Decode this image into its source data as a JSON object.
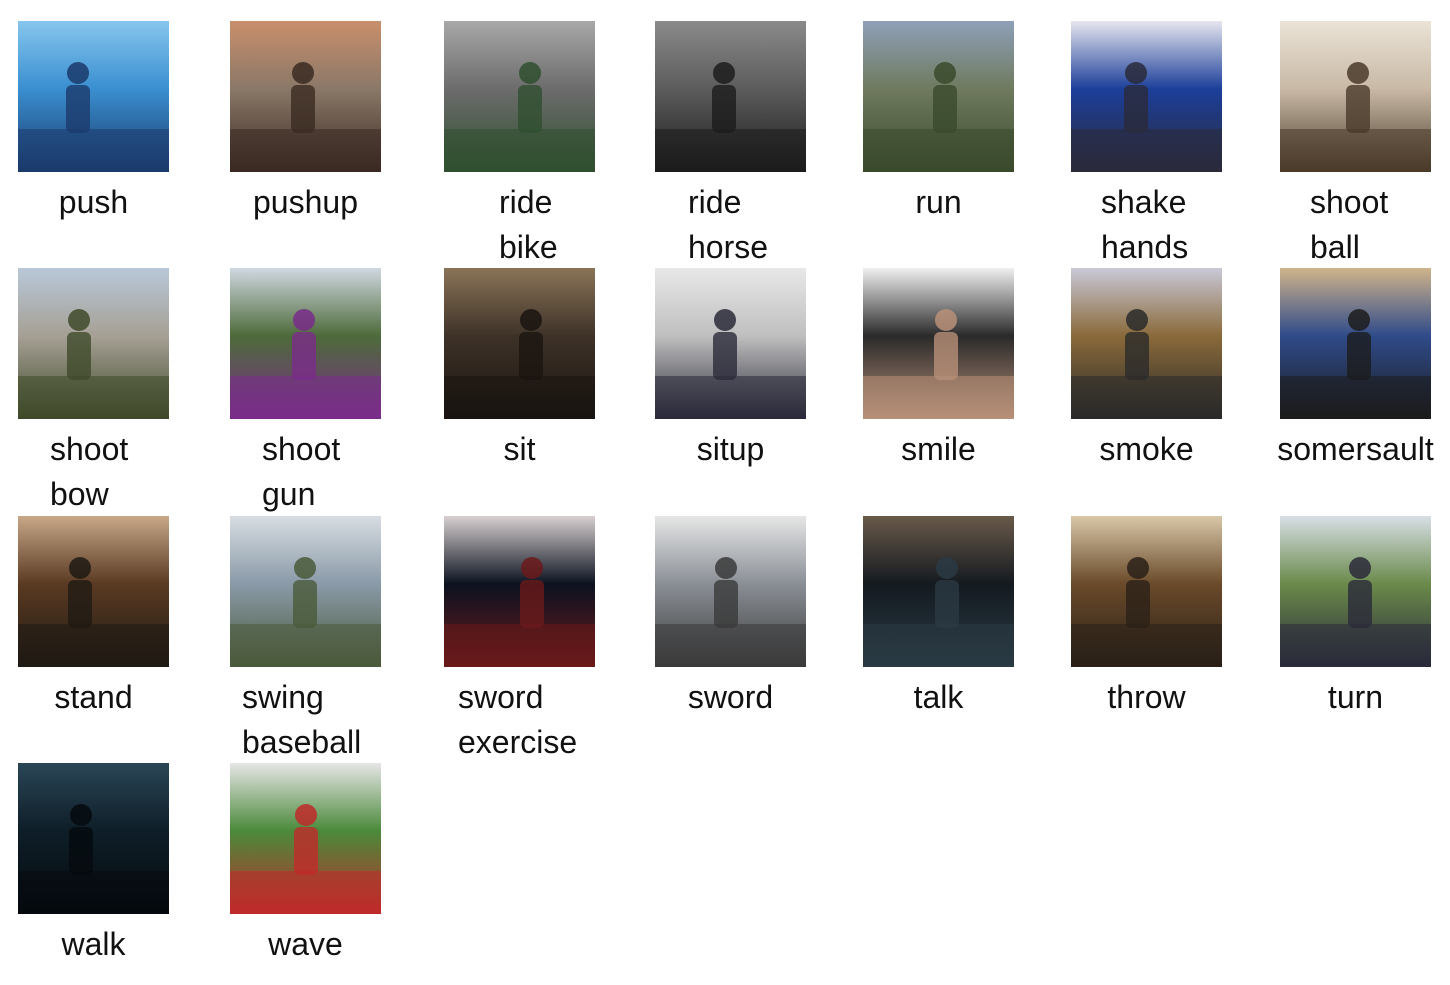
{
  "items": [
    {
      "label": "push",
      "thumb": "person-pushing-outdoors-thumbnail",
      "colors": [
        "#3a8fd0",
        "#86c6ee",
        "#1b3a6b"
      ]
    },
    {
      "label": "pushup",
      "thumb": "person-doing-pushup-thumbnail",
      "colors": [
        "#8a7868",
        "#c98f6b",
        "#3a2a22"
      ]
    },
    {
      "label": "ride\nbike",
      "thumb": "cycling-race-broadcast-thumbnail",
      "colors": [
        "#6c6c6c",
        "#a8a8a8",
        "#2f4f2f"
      ]
    },
    {
      "label": "ride\nhorse",
      "thumb": "horse-race-grayscale-thumbnail",
      "colors": [
        "#5c5c5c",
        "#8a8a8a",
        "#1c1c1c"
      ]
    },
    {
      "label": "run",
      "thumb": "person-running-parking-lot-thumbnail",
      "colors": [
        "#6f7a5e",
        "#8ea0b8",
        "#3a4a2c"
      ]
    },
    {
      "label": "shake\nhands",
      "thumb": "wrestlers-shaking-hands-thumbnail",
      "colors": [
        "#1c3f9a",
        "#e6e6ef",
        "#2a2a3a"
      ]
    },
    {
      "label": "shoot\nball",
      "thumb": "basketball-gym-thumbnail",
      "colors": [
        "#c9b9a6",
        "#eae3d6",
        "#4a3a2a"
      ]
    },
    {
      "label": "shoot\nbow",
      "thumb": "person-shooting-pistol-thumbnail",
      "colors": [
        "#a6a095",
        "#b8c8d8",
        "#3f4a2a"
      ]
    },
    {
      "label": "shoot\ngun",
      "thumb": "archer-drawing-bow-thumbnail",
      "colors": [
        "#4d6b3a",
        "#d0d8e0",
        "#7a2c8a"
      ]
    },
    {
      "label": "sit",
      "thumb": "people-sitting-indoors-thumbnail",
      "colors": [
        "#3e3228",
        "#8a7458",
        "#1a1410"
      ]
    },
    {
      "label": "situp",
      "thumb": "person-doing-situp-garage-thumbnail",
      "colors": [
        "#bfbfbf",
        "#e8e8e8",
        "#2a2a3a"
      ]
    },
    {
      "label": "smile",
      "thumb": "person-smiling-webcam-thumbnail",
      "colors": [
        "#2a2a2a",
        "#f0f0f0",
        "#b89078"
      ]
    },
    {
      "label": "smoke",
      "thumb": "person-smoking-room-thumbnail",
      "colors": [
        "#8a6a3a",
        "#c9c9d8",
        "#2a2a2a"
      ]
    },
    {
      "label": "somersault",
      "thumb": "gymnast-on-beam-thumbnail",
      "colors": [
        "#2f4b8a",
        "#d0b48a",
        "#1c1c1c"
      ]
    },
    {
      "label": "stand",
      "thumb": "man-standing-at-desk-thumbnail",
      "colors": [
        "#5a3a22",
        "#c8a888",
        "#1f1a14"
      ]
    },
    {
      "label": "swing\nbaseball",
      "thumb": "batting-cage-thumbnail",
      "colors": [
        "#8a9aa8",
        "#d8dde2",
        "#4a5a3a"
      ]
    },
    {
      "label": "sword\nexercise",
      "thumb": "sword-exercise-spotlight-thumbnail",
      "colors": [
        "#0c1220",
        "#d8d0d0",
        "#6a1a1a"
      ]
    },
    {
      "label": "sword",
      "thumb": "person-with-sword-street-thumbnail",
      "colors": [
        "#8a8f96",
        "#e6e6e6",
        "#3a3a3a"
      ]
    },
    {
      "label": "talk",
      "thumb": "person-talking-dark-thumbnail",
      "colors": [
        "#141a20",
        "#6a5a4a",
        "#2a3a44"
      ]
    },
    {
      "label": "throw",
      "thumb": "person-throwing-indoors-thumbnail",
      "colors": [
        "#6a4a2a",
        "#d8c8a8",
        "#2a2018"
      ]
    },
    {
      "label": "turn",
      "thumb": "person-turning-by-fence-thumbnail",
      "colors": [
        "#6a8a4a",
        "#d8dfe6",
        "#2a2a3a"
      ]
    },
    {
      "label": "walk",
      "thumb": "person-walking-night-thumbnail",
      "colors": [
        "#0e1e28",
        "#2a4656",
        "#050a0e"
      ]
    },
    {
      "label": "wave",
      "thumb": "crowd-waving-field-thumbnail",
      "colors": [
        "#4a8a3a",
        "#e6e6e6",
        "#c02a2a"
      ]
    }
  ]
}
